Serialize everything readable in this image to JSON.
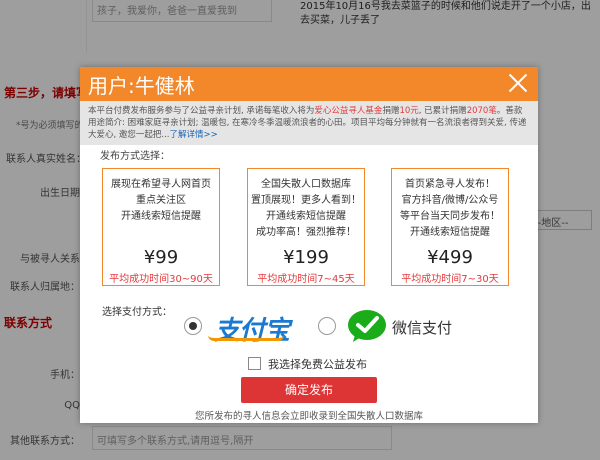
{
  "background": {
    "top_input_placeholder": "孩子，我爱你，爸爸一直爱我到",
    "top_text": "2015年10月16号我去菜篮子的时候和他们说走开了一个小店，出去买菜，儿子丢了",
    "step_title": "第三步，请填写联",
    "required_hint": "*号为必须填写的",
    "labels": {
      "name": "联系人真实姓名：",
      "birth": "出生日期",
      "relation": "与被寻人关系",
      "location": "联系人归属地：",
      "phone": "手机：",
      "qq": "QQ",
      "other": "其他联系方式："
    },
    "section_title": "联系方式",
    "district_select": "--地区--",
    "other_input_placeholder": "可填写多个联系方式,请用逗号,隔开"
  },
  "modal": {
    "title": "用户:牛健林",
    "notice": {
      "part1": "本平台付费发布服务参与了公益寻亲计划, 承诺每笔收入将为",
      "highlight1": "爱心公益寻人基金",
      "part2": "捐赠",
      "amount1": "10元",
      "part3": ", 已累计捐赠",
      "amount2": "2070笔",
      "part4": "。善款用途简介: 困难家庭寻亲计划; 温暖包, 在寒冷冬季温暖流浪者的心田。项目平均每分钟就有一名流浪者得到关爱, 传递大爱心, 邀您一起把...",
      "link": "了解详情>>"
    },
    "section_title": "发布方式选择：",
    "packages": [
      {
        "lines": [
          "展现在希望寻人网首页",
          "重点关注区",
          "开通线索短信提醒"
        ],
        "price": "¥99",
        "duration": "平均成功时间30~90天"
      },
      {
        "lines": [
          "全国失散人口数据库",
          "置顶展现！更多人看到！",
          "开通线索短信提醒",
          "成功率高！强烈推荐！"
        ],
        "price": "¥199",
        "duration": "平均成功时间7~45天"
      },
      {
        "lines": [
          "首页紧急寻人发布！",
          "官方抖音/微博/公众号",
          "等平台当天同步发布！",
          "开通线索短信提醒"
        ],
        "price": "¥499",
        "duration": "平均成功时间7~30天"
      }
    ],
    "payment_label": "选择支付方式：",
    "alipay_name": "支付宝",
    "wechat_name": "微信支付",
    "free_option": "我选择免费公益发布",
    "confirm_button": "确定发布",
    "footer": "您所发布的寻人信息会立即收录到全国失散人口数据库",
    "colors": {
      "header": "#f3882b",
      "accent_red": "#e4393c",
      "button": "#dd3535",
      "alipay": "#1a7ad1",
      "wechat": "#1aad19"
    }
  }
}
